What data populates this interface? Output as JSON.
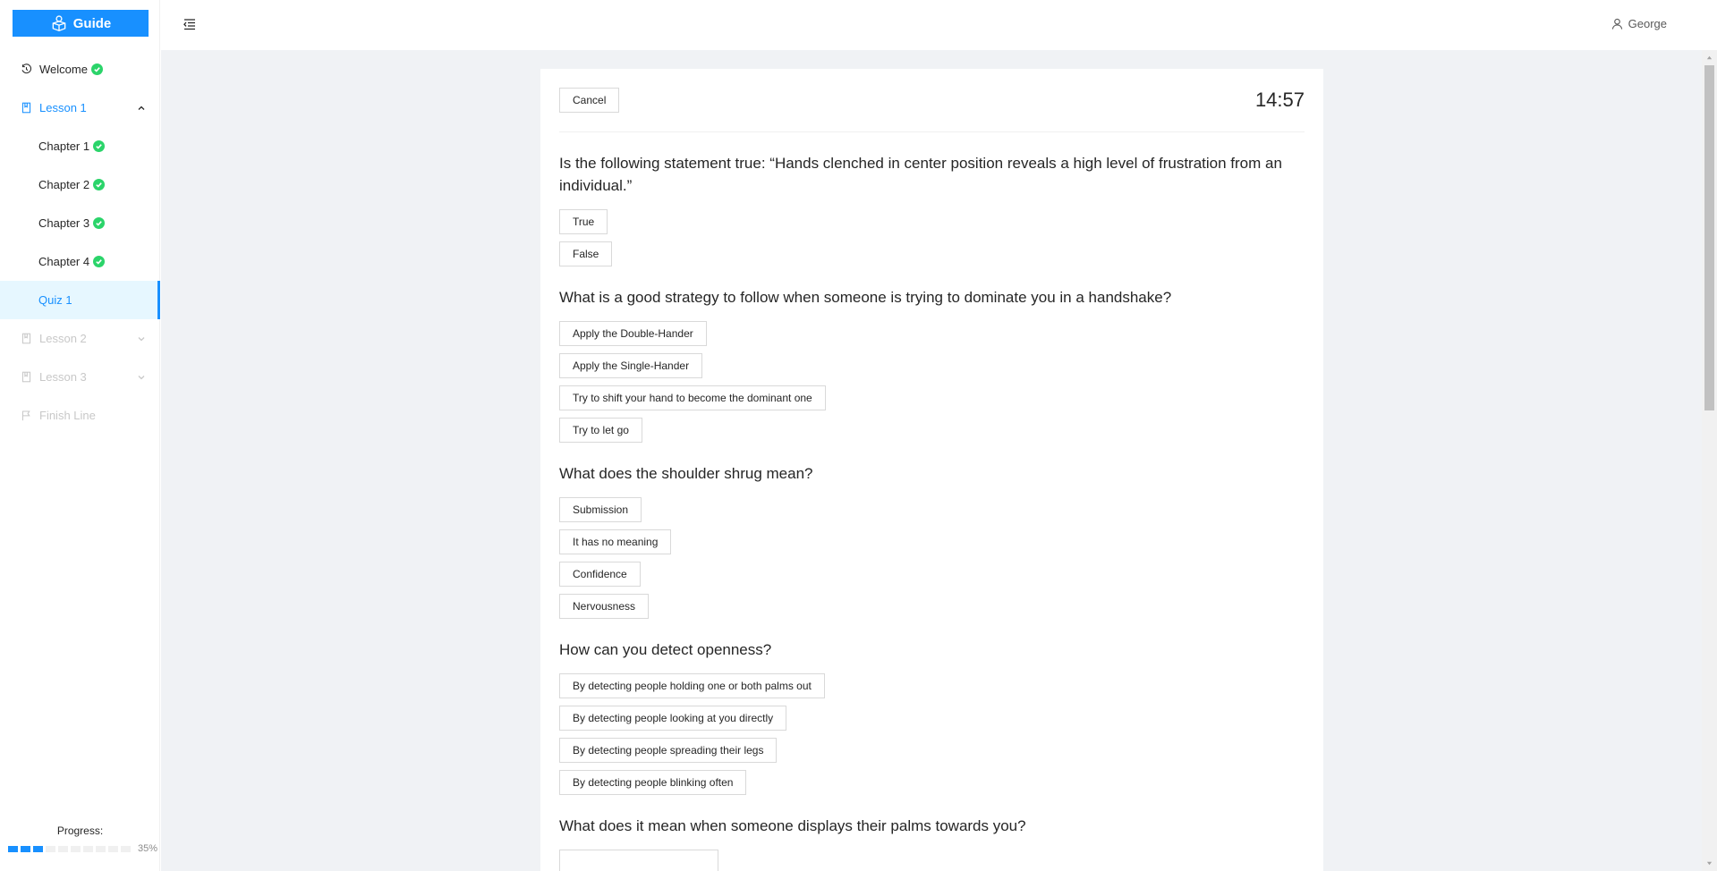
{
  "app": {
    "logo_label": "Guide"
  },
  "header": {
    "user_name": "George"
  },
  "sidebar": {
    "items": [
      {
        "label": "Welcome",
        "done": true
      },
      {
        "label": "Lesson 1",
        "expanded": true
      },
      {
        "label": "Chapter 1",
        "done": true
      },
      {
        "label": "Chapter 2",
        "done": true
      },
      {
        "label": "Chapter 3",
        "done": true
      },
      {
        "label": "Chapter 4",
        "done": true
      },
      {
        "label": "Quiz 1",
        "selected": true
      },
      {
        "label": "Lesson 2",
        "disabled": true
      },
      {
        "label": "Lesson 3",
        "disabled": true
      },
      {
        "label": "Finish Line",
        "disabled": true
      }
    ],
    "progress": {
      "label": "Progress:",
      "percent_text": "35%",
      "segments_total": 10,
      "segments_filled": 3
    }
  },
  "quiz": {
    "cancel_label": "Cancel",
    "timer": "14:57",
    "questions": [
      {
        "text": "Is the following statement true: “Hands clenched in center position reveals a high level of frustration from an individual.”",
        "options": [
          "True",
          "False"
        ]
      },
      {
        "text": "What is a good strategy to follow when someone is trying to dominate you in a handshake?",
        "options": [
          "Apply the Double-Hander",
          "Apply the Single-Hander",
          "Try to shift your hand to become the dominant one",
          "Try to let go"
        ]
      },
      {
        "text": "What does the shoulder shrug mean?",
        "options": [
          "Submission",
          "It has no meaning",
          "Confidence",
          "Nervousness"
        ]
      },
      {
        "text": "How can you detect openness?",
        "options": [
          "By detecting people holding one or both palms out",
          "By detecting people looking at you directly",
          "By detecting people spreading their legs",
          "By detecting people blinking often"
        ]
      },
      {
        "text": "What does it mean when someone displays their palms towards you?",
        "options": []
      }
    ]
  },
  "colors": {
    "accent": "#1890ff",
    "success": "#2bd46a",
    "content_bg": "#f0f2f5"
  }
}
